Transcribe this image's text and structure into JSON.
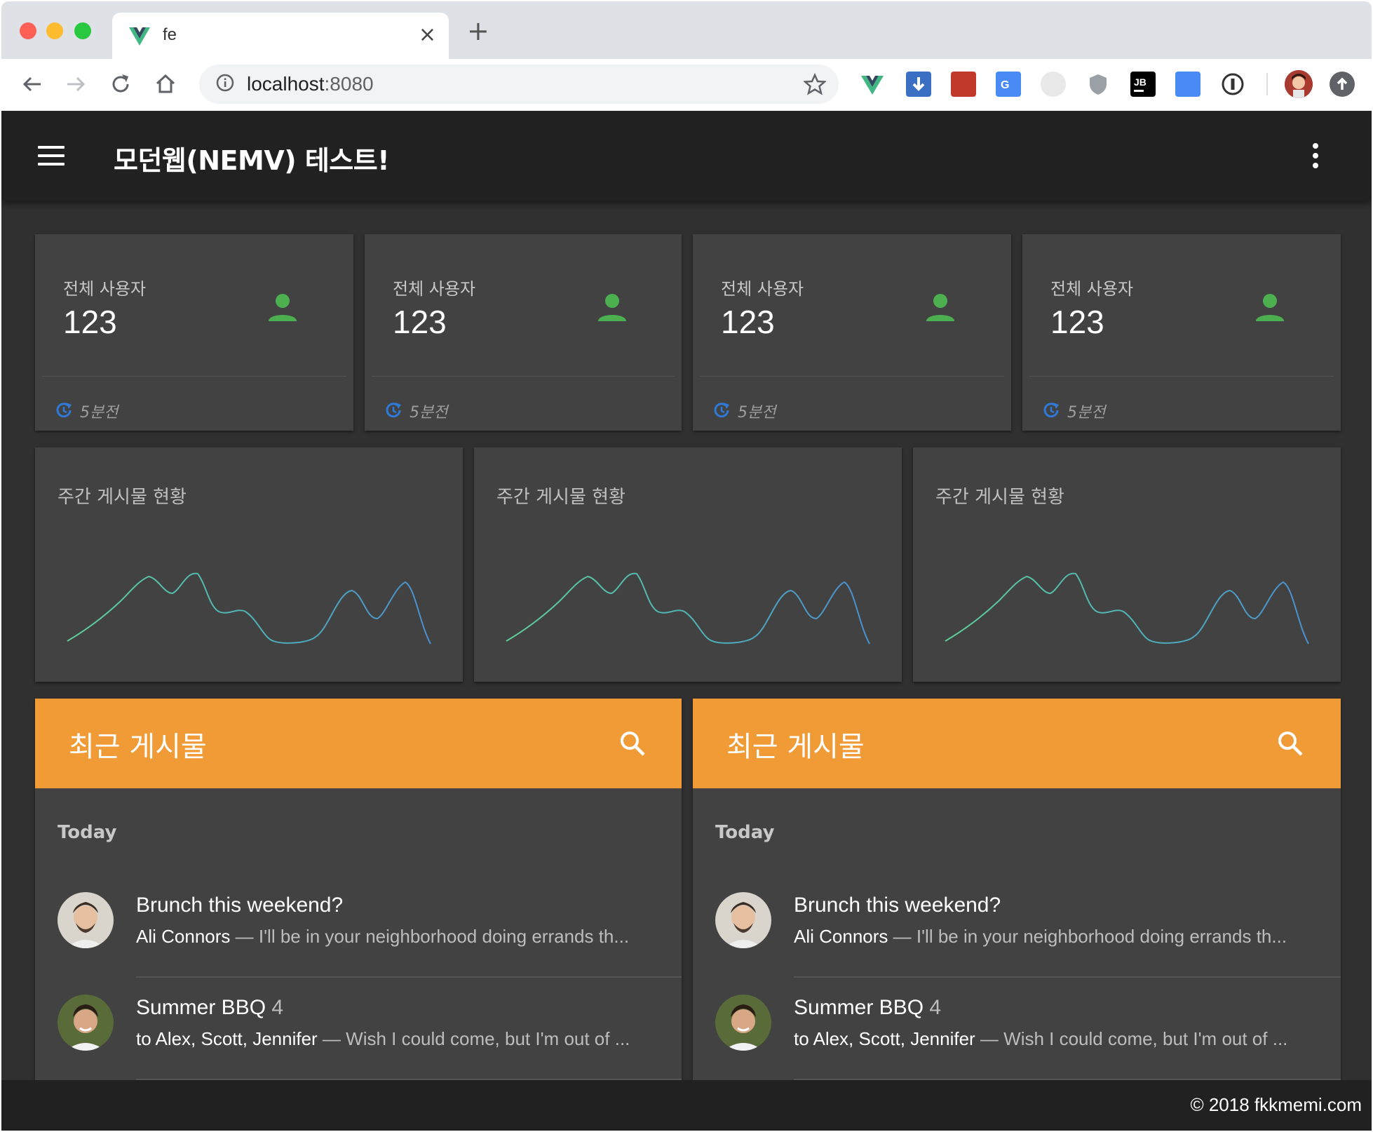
{
  "browser": {
    "tab_title": "fe",
    "tab_close": "×",
    "new_tab": "+",
    "url_host": "localhost",
    "url_port": ":8080"
  },
  "app": {
    "title": "모던웹(NEMV) 테스트!",
    "footer": "© 2018 fkkmemi.com"
  },
  "stats": [
    {
      "label": "전체 사용자",
      "value": "123",
      "time": "5분전"
    },
    {
      "label": "전체 사용자",
      "value": "123",
      "time": "5분전"
    },
    {
      "label": "전체 사용자",
      "value": "123",
      "time": "5분전"
    },
    {
      "label": "전체 사용자",
      "value": "123",
      "time": "5분전"
    }
  ],
  "weekly_charts": [
    {
      "title": "주간 게시물 현황"
    },
    {
      "title": "주간 게시물 현황"
    },
    {
      "title": "주간 게시물 현황"
    }
  ],
  "posts_panels": [
    {
      "title": "최근 게시물",
      "subheader": "Today",
      "items": [
        {
          "title": "Brunch this weekend?",
          "count": "",
          "author": "Ali Connors",
          "preview": " — I'll be in your neighborhood doing errands th..."
        },
        {
          "title": "Summer BBQ",
          "count": "4",
          "author": "to Alex, Scott, Jennifer",
          "preview": " — Wish I could come, but I'm out of ..."
        }
      ]
    },
    {
      "title": "최근 게시물",
      "subheader": "Today",
      "items": [
        {
          "title": "Brunch this weekend?",
          "count": "",
          "author": "Ali Connors",
          "preview": " — I'll be in your neighborhood doing errands th..."
        },
        {
          "title": "Summer BBQ",
          "count": "4",
          "author": "to Alex, Scott, Jennifer",
          "preview": " — Wish I could come, but I'm out of ..."
        }
      ]
    }
  ],
  "colors": {
    "appbar": "#212121",
    "background": "#303030",
    "card": "#424242",
    "accent_orange": "#f19b37",
    "icon_green": "#4caf50",
    "clock_blue": "#2f7ad8"
  }
}
